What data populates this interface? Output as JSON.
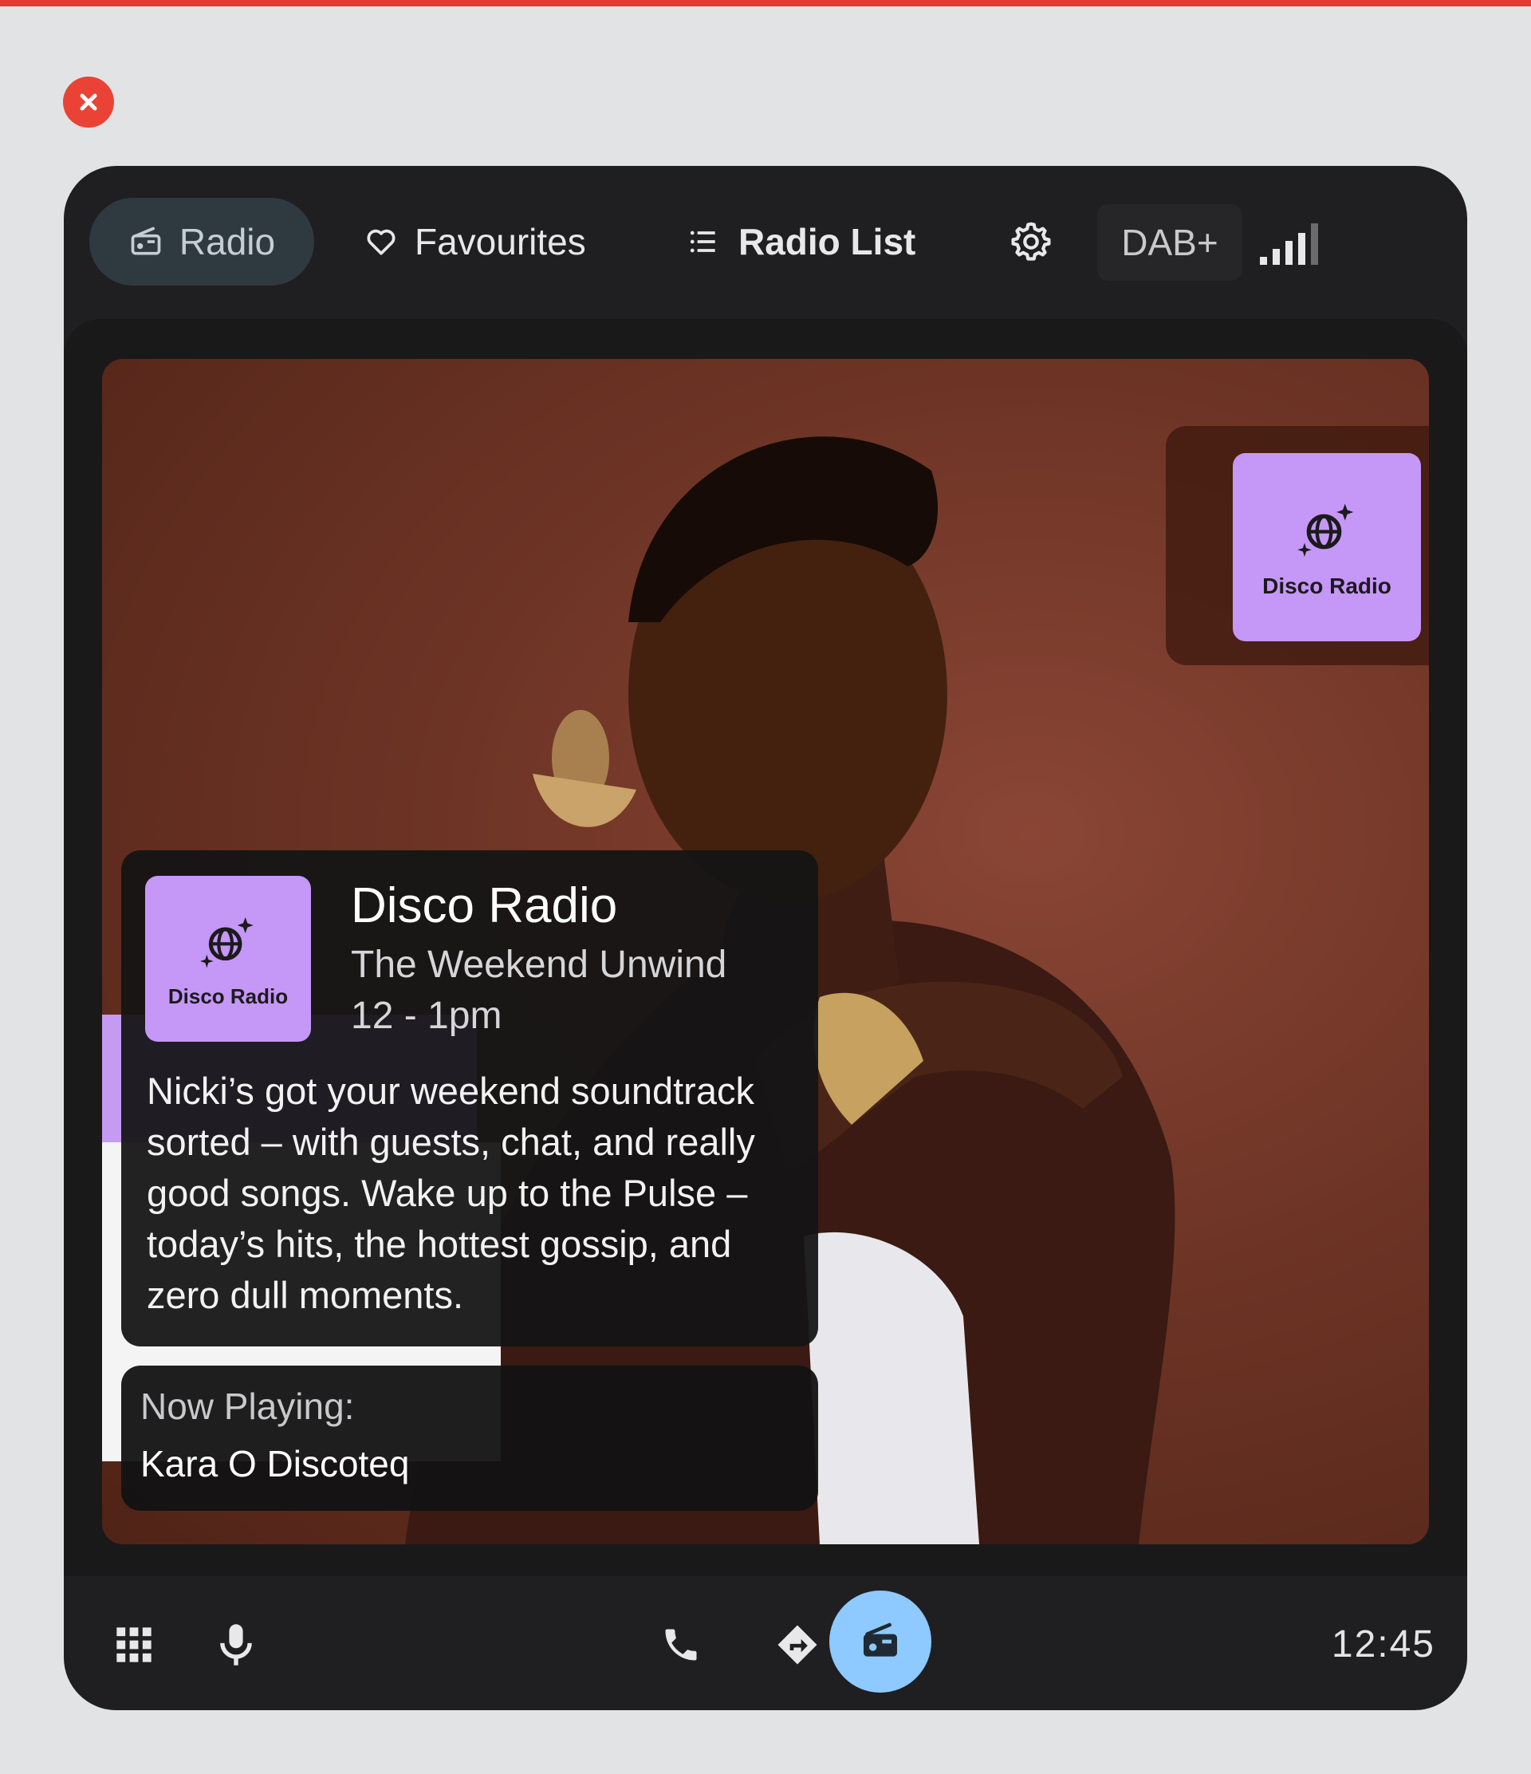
{
  "nav": {
    "radio_label": "Radio",
    "favourites_label": "Favourites",
    "radio_list_label": "Radio List",
    "dab_label": "DAB+"
  },
  "side_chip": {
    "logo_text": "Disco Radio"
  },
  "now_playing_card": {
    "logo_text": "Disco Radio",
    "station": "Disco Radio",
    "show": "The Weekend Unwind",
    "time": "12 - 1pm",
    "description": "Nicki’s got your weekend soundtrack sorted – with guests, chat, and really good songs. Wake up to the Pulse – today’s hits, the hottest gossip, and zero dull moments."
  },
  "now_playing": {
    "label": "Now Playing:",
    "track": "Kara O  Discoteq"
  },
  "bottom_bar": {
    "clock": "12:45"
  },
  "colors": {
    "accent_radio_button": "#8ec9ff",
    "logo_tile": "#c597f7",
    "close_button": "#ea4335",
    "top_stripe": "#e53935"
  },
  "signal_strength_bars": 4
}
